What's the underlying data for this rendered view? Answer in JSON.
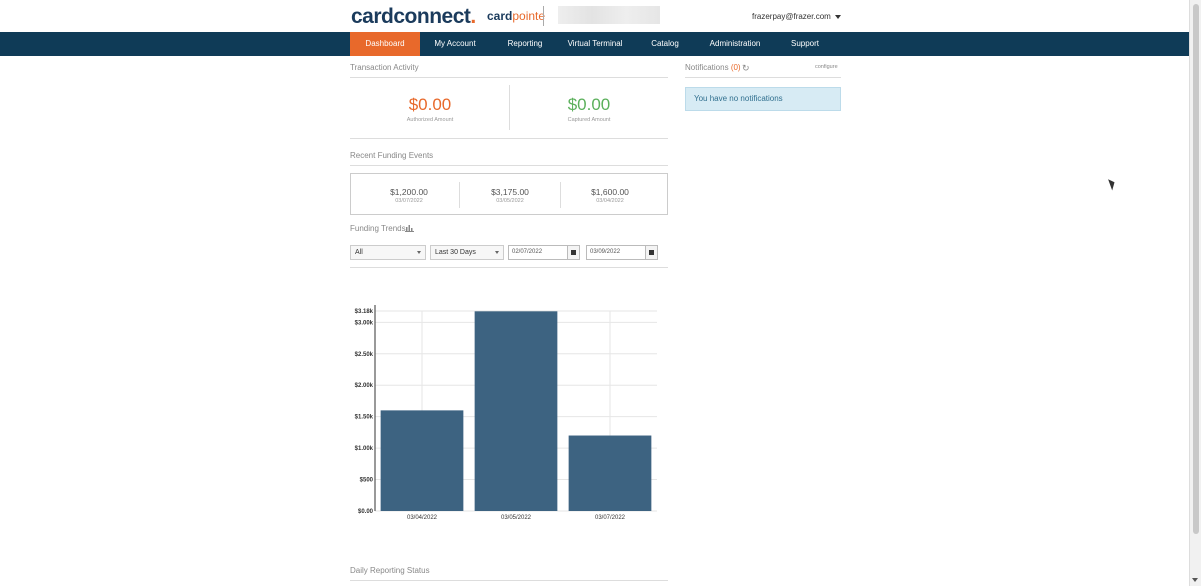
{
  "header": {
    "logo_card": "cardconnect",
    "logo_dot": ".",
    "logo_pointe_a": "card",
    "logo_pointe_b": "pointe",
    "user_email": "frazerpay@frazer.com"
  },
  "nav": [
    {
      "label": "Dashboard",
      "active": true
    },
    {
      "label": "My Account",
      "active": false
    },
    {
      "label": "Reporting",
      "active": false
    },
    {
      "label": "Virtual Terminal",
      "active": false
    },
    {
      "label": "Catalog",
      "active": false
    },
    {
      "label": "Administration",
      "active": false
    },
    {
      "label": "Support",
      "active": false
    }
  ],
  "transaction_activity": {
    "title": "Transaction Activity",
    "authorized_amount": "$0.00",
    "authorized_label": "Authorized Amount",
    "captured_amount": "$0.00",
    "captured_label": "Captured Amount"
  },
  "recent_funding": {
    "title": "Recent Funding Events",
    "events": [
      {
        "amount": "$1,200.00",
        "date": "03/07/2022"
      },
      {
        "amount": "$3,175.00",
        "date": "03/05/2022"
      },
      {
        "amount": "$1,600.00",
        "date": "03/04/2022"
      }
    ]
  },
  "funding_trends": {
    "title": "Funding Trends",
    "chart_icon": "bar-chart-icon",
    "filter_select": "All",
    "range_select": "Last 30 Days",
    "start_date": "02/07/2022",
    "end_date": "03/09/2022"
  },
  "notifications": {
    "title": "Notifications",
    "count": "(0)",
    "configure": "configure",
    "message": "You have no notifications"
  },
  "daily_reporting": {
    "title": "Daily Reporting Status"
  },
  "colors": {
    "brand_navy": "#0f3b57",
    "accent_orange": "#e8692b",
    "captured_green": "#5bb05b",
    "bar_color": "#3d6381"
  },
  "chart_data": {
    "type": "bar",
    "categories": [
      "03/04/2022",
      "03/05/2022",
      "03/07/2022"
    ],
    "values": [
      1600,
      3175,
      1200
    ],
    "ytick_values": [
      0,
      500,
      1000,
      1500,
      2000,
      2500,
      3000,
      3180
    ],
    "ytick_labels": [
      "$0.00",
      "$500",
      "$1.00k",
      "$1.50k",
      "$2.00k",
      "$2.50k",
      "$3.00k",
      "$3.18k"
    ],
    "ylim": [
      0,
      3180
    ],
    "grid": true
  }
}
